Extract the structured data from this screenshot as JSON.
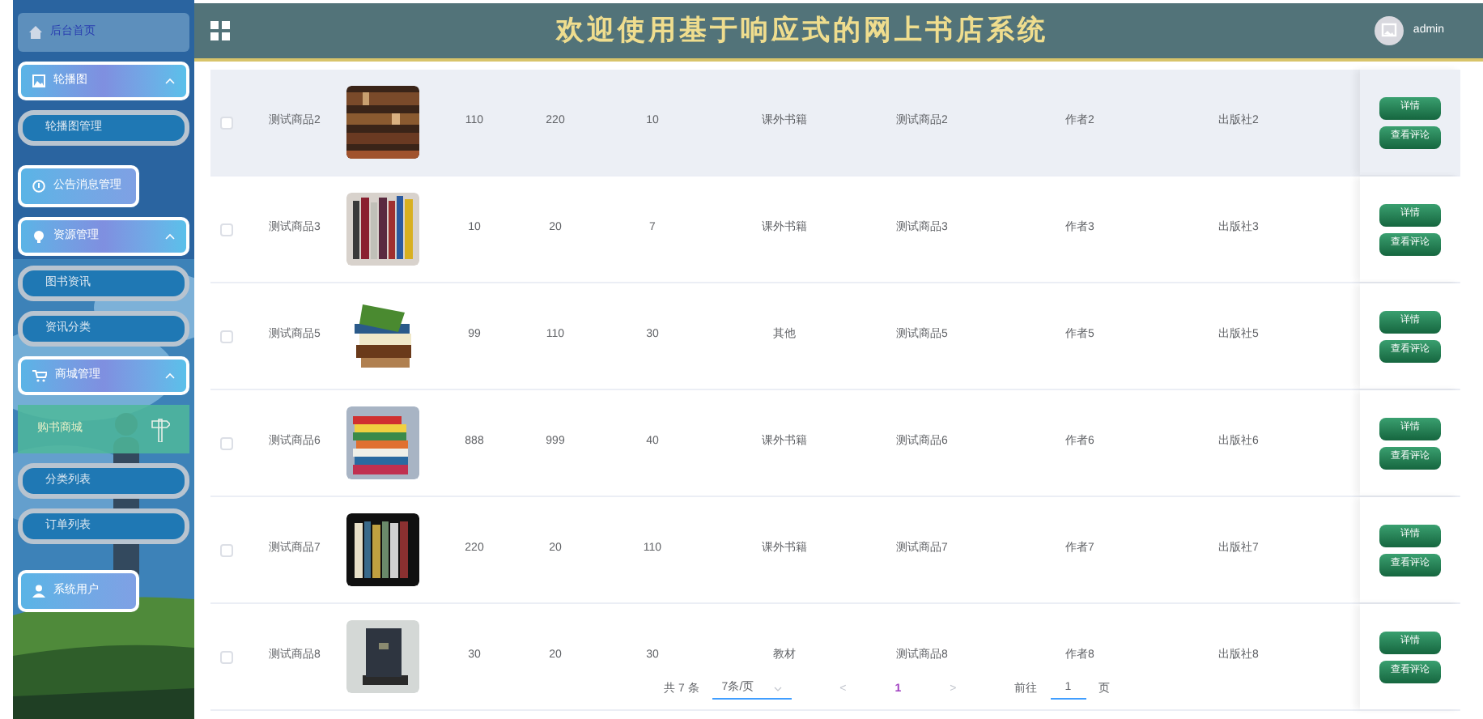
{
  "header": {
    "title": "欢迎使用基于响应式的网上书店系统",
    "user": "admin"
  },
  "sidebar": {
    "items": [
      {
        "kind": "home",
        "label": "后台首页"
      },
      {
        "kind": "group",
        "label": "轮播图",
        "expanded": true,
        "children": [
          {
            "label": "轮播图管理",
            "selected": false
          }
        ]
      },
      {
        "kind": "single",
        "label": "公告消息管理"
      },
      {
        "kind": "group",
        "label": "资源管理",
        "expanded": true,
        "children": [
          {
            "label": "图书资讯",
            "selected": false
          },
          {
            "label": "资讯分类",
            "selected": false
          }
        ]
      },
      {
        "kind": "group",
        "label": "商城管理",
        "expanded": true,
        "children": [
          {
            "label": "购书商城",
            "selected": true
          },
          {
            "label": "分类列表",
            "selected": false
          },
          {
            "label": "订单列表",
            "selected": false
          }
        ]
      },
      {
        "kind": "single",
        "label": "系统用户"
      }
    ]
  },
  "table": {
    "rows": [
      {
        "checked": false,
        "highlighted": true,
        "name": "测试商品2",
        "values": [
          "110",
          "220",
          "10",
          "课外书籍",
          "测试商品2",
          "作者2",
          "出版社2"
        ],
        "actions": [
          "详情",
          "查看评论"
        ]
      },
      {
        "checked": false,
        "highlighted": false,
        "name": "测试商品3",
        "values": [
          "10",
          "20",
          "7",
          "课外书籍",
          "测试商品3",
          "作者3",
          "出版社3"
        ],
        "actions": [
          "详情",
          "查看评论"
        ]
      },
      {
        "checked": false,
        "highlighted": false,
        "name": "测试商品5",
        "values": [
          "99",
          "110",
          "30",
          "其他",
          "测试商品5",
          "作者5",
          "出版社5"
        ],
        "actions": [
          "详情",
          "查看评论"
        ]
      },
      {
        "checked": false,
        "highlighted": false,
        "name": "测试商品6",
        "values": [
          "888",
          "999",
          "40",
          "课外书籍",
          "测试商品6",
          "作者6",
          "出版社6"
        ],
        "actions": [
          "详情",
          "查看评论"
        ]
      },
      {
        "checked": false,
        "highlighted": false,
        "name": "测试商品7",
        "values": [
          "220",
          "20",
          "110",
          "课外书籍",
          "测试商品7",
          "作者7",
          "出版社7"
        ],
        "actions": [
          "详情",
          "查看评论"
        ]
      },
      {
        "checked": false,
        "highlighted": false,
        "name": "测试商品8",
        "values": [
          "30",
          "20",
          "30",
          "教材",
          "测试商品8",
          "作者8",
          "出版社8"
        ],
        "actions": [
          "详情",
          "查看评论"
        ]
      }
    ]
  },
  "pagination": {
    "total": "共 7 条",
    "page_size": "7条/页",
    "prev": "<",
    "pages": [
      {
        "label": "1",
        "selected": true
      }
    ],
    "next": ">",
    "goto_label": "前往",
    "goto_value": "1",
    "goto_suffix": "页"
  }
}
